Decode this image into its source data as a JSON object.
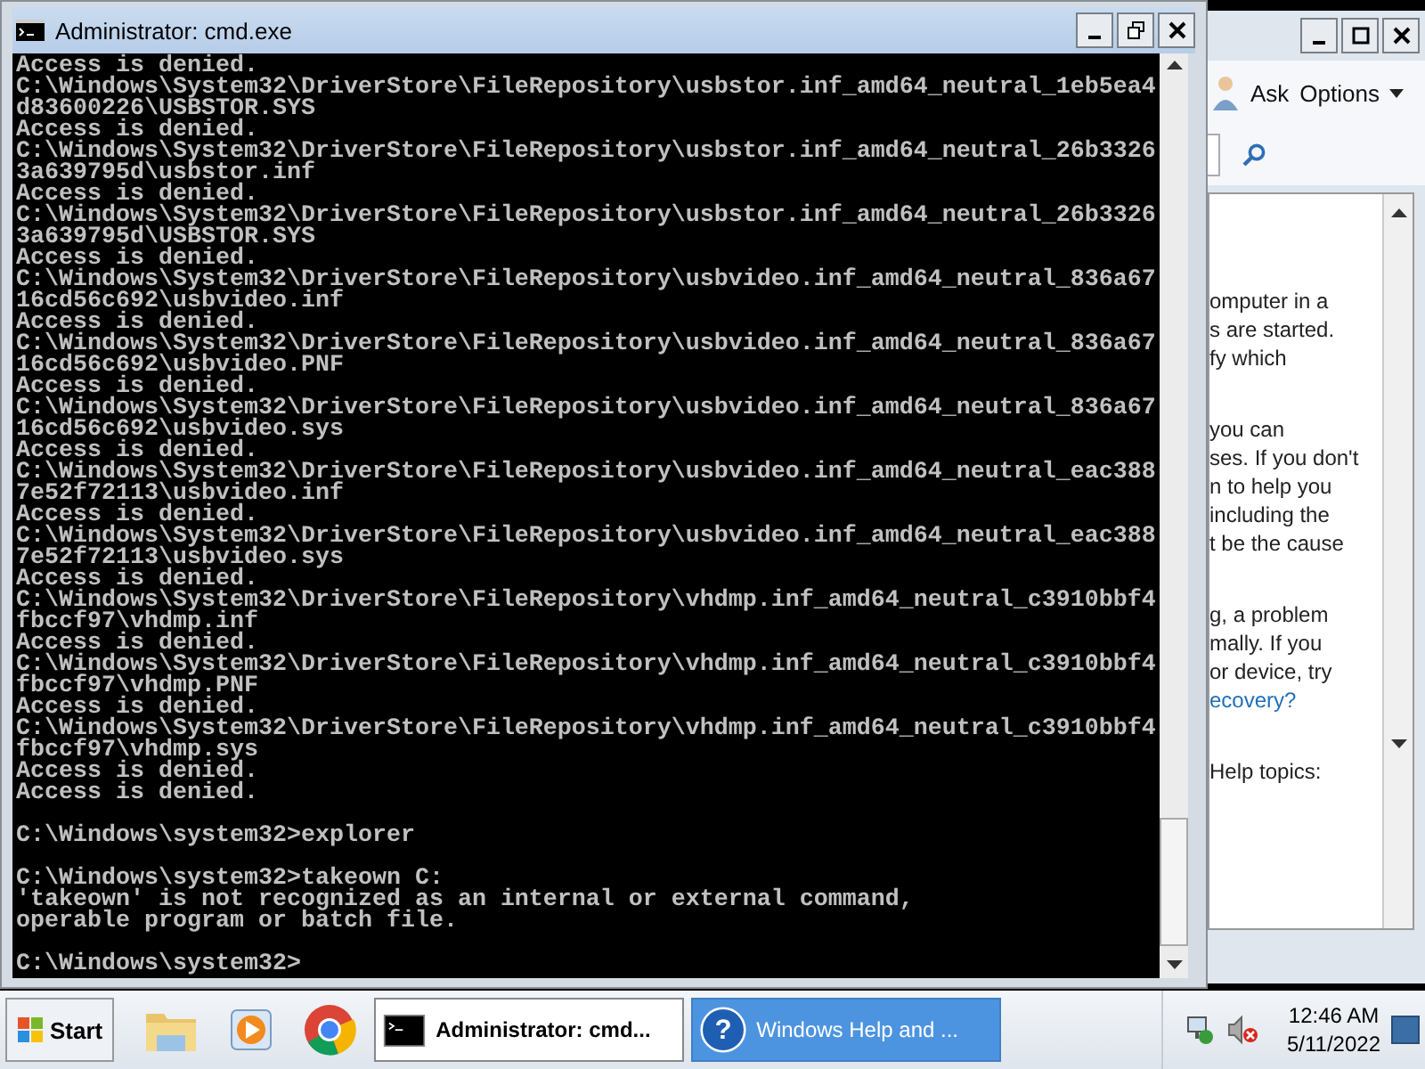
{
  "cmd_window": {
    "title": "Administrator: cmd.exe",
    "lines": [
      {
        "kind": "text",
        "text": "Access is denied."
      },
      {
        "kind": "text",
        "text": "C:\\Windows\\System32\\DriverStore\\FileRepository\\usbstor.inf_amd64_neutral_1eb5ea4"
      },
      {
        "kind": "text",
        "text": "d83600226\\USBSTOR.SYS"
      },
      {
        "kind": "text",
        "text": "Access is denied."
      },
      {
        "kind": "text",
        "text": "C:\\Windows\\System32\\DriverStore\\FileRepository\\usbstor.inf_amd64_neutral_26b3326"
      },
      {
        "kind": "text",
        "text": "3a639795d\\usbstor.inf"
      },
      {
        "kind": "text",
        "text": "Access is denied."
      },
      {
        "kind": "text",
        "text": "C:\\Windows\\System32\\DriverStore\\FileRepository\\usbstor.inf_amd64_neutral_26b3326"
      },
      {
        "kind": "text",
        "text": "3a639795d\\USBSTOR.SYS"
      },
      {
        "kind": "text",
        "text": "Access is denied."
      },
      {
        "kind": "text",
        "text": "C:\\Windows\\System32\\DriverStore\\FileRepository\\usbvideo.inf_amd64_neutral_836a67"
      },
      {
        "kind": "text",
        "text": "16cd56c692\\usbvideo.inf"
      },
      {
        "kind": "text",
        "text": "Access is denied."
      },
      {
        "kind": "text",
        "text": "C:\\Windows\\System32\\DriverStore\\FileRepository\\usbvideo.inf_amd64_neutral_836a67"
      },
      {
        "kind": "text",
        "text": "16cd56c692\\usbvideo.PNF"
      },
      {
        "kind": "text",
        "text": "Access is denied."
      },
      {
        "kind": "text",
        "text": "C:\\Windows\\System32\\DriverStore\\FileRepository\\usbvideo.inf_amd64_neutral_836a67"
      },
      {
        "kind": "text",
        "text": "16cd56c692\\usbvideo.sys"
      },
      {
        "kind": "text",
        "text": "Access is denied."
      },
      {
        "kind": "text",
        "text": "C:\\Windows\\System32\\DriverStore\\FileRepository\\usbvideo.inf_amd64_neutral_eac388"
      },
      {
        "kind": "text",
        "text": "7e52f72113\\usbvideo.inf"
      },
      {
        "kind": "text",
        "text": "Access is denied."
      },
      {
        "kind": "text",
        "text": "C:\\Windows\\System32\\DriverStore\\FileRepository\\usbvideo.inf_amd64_neutral_eac388"
      },
      {
        "kind": "text",
        "text": "7e52f72113\\usbvideo.sys"
      },
      {
        "kind": "text",
        "text": "Access is denied."
      },
      {
        "kind": "text",
        "text": "C:\\Windows\\System32\\DriverStore\\FileRepository\\vhdmp.inf_amd64_neutral_c3910bbf4"
      },
      {
        "kind": "text",
        "text": "fbccf97\\vhdmp.inf"
      },
      {
        "kind": "text",
        "text": "Access is denied."
      },
      {
        "kind": "text",
        "text": "C:\\Windows\\System32\\DriverStore\\FileRepository\\vhdmp.inf_amd64_neutral_c3910bbf4"
      },
      {
        "kind": "text",
        "text": "fbccf97\\vhdmp.PNF"
      },
      {
        "kind": "text",
        "text": "Access is denied."
      },
      {
        "kind": "text",
        "text": "C:\\Windows\\System32\\DriverStore\\FileRepository\\vhdmp.inf_amd64_neutral_c3910bbf4"
      },
      {
        "kind": "text",
        "text": "fbccf97\\vhdmp.sys"
      },
      {
        "kind": "text",
        "text": "Access is denied."
      },
      {
        "kind": "text",
        "text": "Access is denied."
      },
      {
        "kind": "blank"
      },
      {
        "kind": "text",
        "text": "C:\\Windows\\system32>explorer"
      },
      {
        "kind": "blank"
      },
      {
        "kind": "text",
        "text": "C:\\Windows\\system32>takeown C:"
      },
      {
        "kind": "text",
        "text": "'takeown' is not recognized as an internal or external command,"
      },
      {
        "kind": "text",
        "text": "operable program or batch file."
      },
      {
        "kind": "blank"
      },
      {
        "kind": "text",
        "text": "C:\\Windows\\system32>"
      }
    ]
  },
  "help_window": {
    "toolbar": [
      {
        "label": "Ask",
        "caret": false
      },
      {
        "label": "Options",
        "caret": true
      }
    ],
    "paragraphs": [
      {
        "lines": [
          {
            "kind": "text",
            "text": "omputer in a"
          },
          {
            "kind": "text",
            "text": "s are started."
          },
          {
            "kind": "text",
            "text": "fy which"
          }
        ]
      },
      {
        "lines": [
          {
            "kind": "text",
            "text": "you can"
          },
          {
            "kind": "text",
            "text": "ses. If you don't"
          },
          {
            "kind": "text",
            "text": "n to help you"
          },
          {
            "kind": "text",
            "text": "including the"
          },
          {
            "kind": "text",
            "text": "t be the cause"
          }
        ]
      },
      {
        "lines": [
          {
            "kind": "text",
            "text": "g, a problem"
          },
          {
            "kind": "text",
            "text": "mally. If you"
          },
          {
            "kind": "text",
            "text": "or device, try"
          },
          {
            "kind": "link",
            "text": "ecovery?"
          }
        ]
      },
      {
        "lines": [
          {
            "kind": "text",
            "text": "Help topics:"
          }
        ]
      }
    ]
  },
  "taskbar": {
    "start": "Start",
    "tasks": [
      {
        "label": "Administrator: cmd...",
        "kind": "console",
        "selected": true
      },
      {
        "label": "Windows Help and ...",
        "kind": "help",
        "icon": "?",
        "selected": false
      }
    ],
    "time": "12:46 AM",
    "date": "5/11/2022"
  }
}
